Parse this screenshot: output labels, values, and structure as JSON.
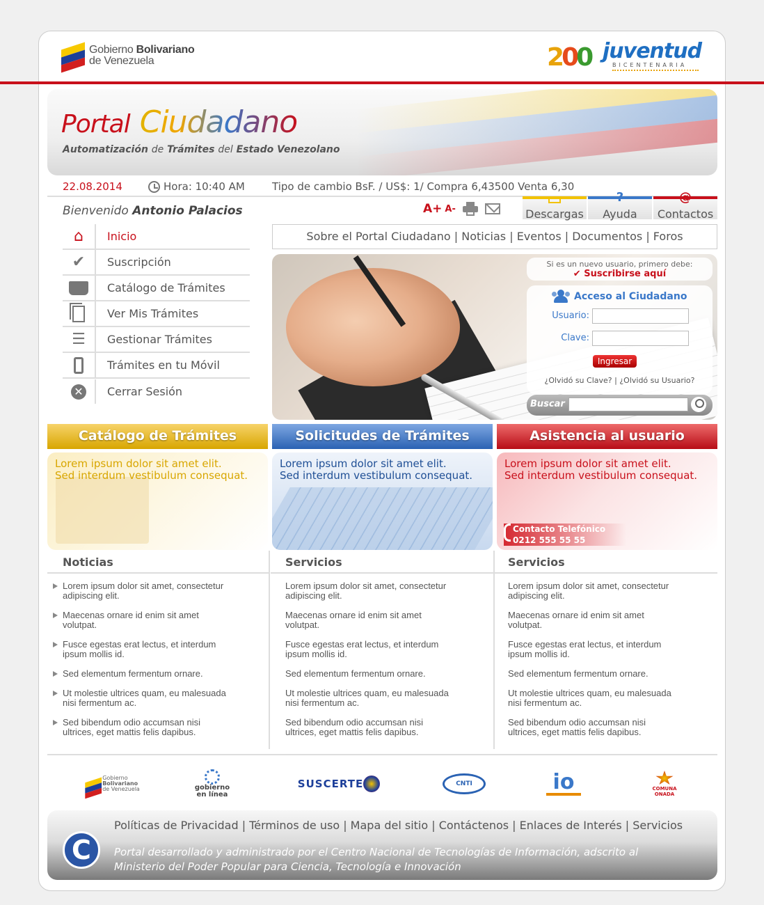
{
  "header": {
    "gob_logo_line1": "Gobierno",
    "gob_logo_line1_bold": "Bolivariano",
    "gob_logo_line2": "de Venezuela",
    "juventud_word": "juventud",
    "juventud_sub": "BICENTENARIA"
  },
  "banner": {
    "title_part1": "Portal",
    "title_part2": "Ciudadano",
    "subtitle_b1": "Automatización",
    "subtitle_l1": "de",
    "subtitle_b2": "Trámites",
    "subtitle_l2": "del",
    "subtitle_b3": "Estado Venezolano"
  },
  "infobar": {
    "date": "22.08.2014",
    "time": "Hora: 10:40 AM",
    "exchange": "Tipo de cambio BsF. / US$: 1/ Compra 6,43500 Venta 6,30"
  },
  "welcome": {
    "prefix": "Bienvenido",
    "user": "Antonio Palacios"
  },
  "tools": {
    "font_up": "A+",
    "font_down": "A-"
  },
  "tabs": [
    {
      "label": "Descargas",
      "color": "#f2c200"
    },
    {
      "label": "Ayuda",
      "color": "#3a78c9",
      "icon": "?"
    },
    {
      "label": "Contactos",
      "color": "#c8101b",
      "icon": "@"
    }
  ],
  "menu": [
    {
      "label": "Inicio",
      "icon": "home-icon"
    },
    {
      "label": "Suscripción",
      "icon": "check-icon"
    },
    {
      "label": "Catálogo de Trámites",
      "icon": "book-icon"
    },
    {
      "label": "Ver Mis Trámites",
      "icon": "documents-icon"
    },
    {
      "label": "Gestionar Trámites",
      "icon": "list-icon"
    },
    {
      "label": "Trámites en tu Móvil",
      "icon": "mobile-icon"
    },
    {
      "label": "Cerrar Sesión",
      "icon": "close-icon"
    }
  ],
  "topnav": {
    "items": [
      "Sobre el Portal Ciudadano",
      "Noticias",
      "Eventos",
      "Documentos",
      "Foros"
    ]
  },
  "login": {
    "new_user_note": "Si es un nuevo usuario, primero debe:",
    "subscribe_link": "Suscribirse aquí",
    "title": "Acceso al Ciudadano",
    "user_label": "Usuario:",
    "password_label": "Clave:",
    "submit": "Ingresar",
    "forgot": "¿Olvidó su Clave? | ¿Olvidó su Usuario?"
  },
  "search": {
    "label": "Buscar"
  },
  "features": [
    {
      "title": "Catálogo de Trámites",
      "line1": "Lorem ipsum dolor sit amet elit.",
      "line2": "Sed interdum vestibulum consequat.",
      "color": "#e2b300"
    },
    {
      "title": "Solicitudes de Trámites",
      "line1": "Lorem ipsum dolor sit amet elit.",
      "line2": "Sed interdum vestibulum consequat.",
      "color": "#3a78c9"
    },
    {
      "title": "Asistencia al usuario",
      "line1": "Lorem ipsum dolor sit amet elit.",
      "line2": "Sed interdum vestibulum consequat.",
      "color": "#c8101b",
      "contact_label": "Contacto Telefónico",
      "contact_phone": "0212 555 55 55"
    }
  ],
  "columns": [
    {
      "heading": "Noticias"
    },
    {
      "heading": "Servicios"
    },
    {
      "heading": "Servicios"
    }
  ],
  "list_items": [
    [
      "Lorem ipsum dolor sit amet, consectetur",
      "adipiscing elit."
    ],
    [
      "Maecenas ornare id enim sit amet",
      "volutpat."
    ],
    [
      "Fusce egestas erat lectus, et interdum",
      "ipsum mollis id."
    ],
    [
      "Sed elementum fermentum ornare.",
      ""
    ],
    [
      "Ut molestie ultrices quam, eu malesuada",
      "nisi fermentum ac."
    ],
    [
      "Sed bibendum odio accumsan nisi",
      "ultrices, eget mattis felis dapibus."
    ]
  ],
  "partners": {
    "gob_l1": "Gobierno",
    "gob_l2": "Bolivariano",
    "gob_l3": "de Venezuela",
    "gel_l1": "gobierno",
    "gel_l2": "en línea",
    "suscerte": "SUSCERTE",
    "cnti": "CNTI",
    "interop": "io",
    "comunidad": "COMUNA ONADA"
  },
  "footer": {
    "links": [
      "Políticas de Privacidad",
      "Términos de uso",
      "Mapa del sitio",
      "Contáctenos",
      "Enlaces de Interés",
      "Servicios"
    ],
    "text_line1": "Portal desarrollado y administrado por el Centro Nacional de Tecnologías de Información, adscrito al",
    "text_line2": "Ministerio del Poder Popular para Ciencia, Tecnología e Innovación"
  }
}
